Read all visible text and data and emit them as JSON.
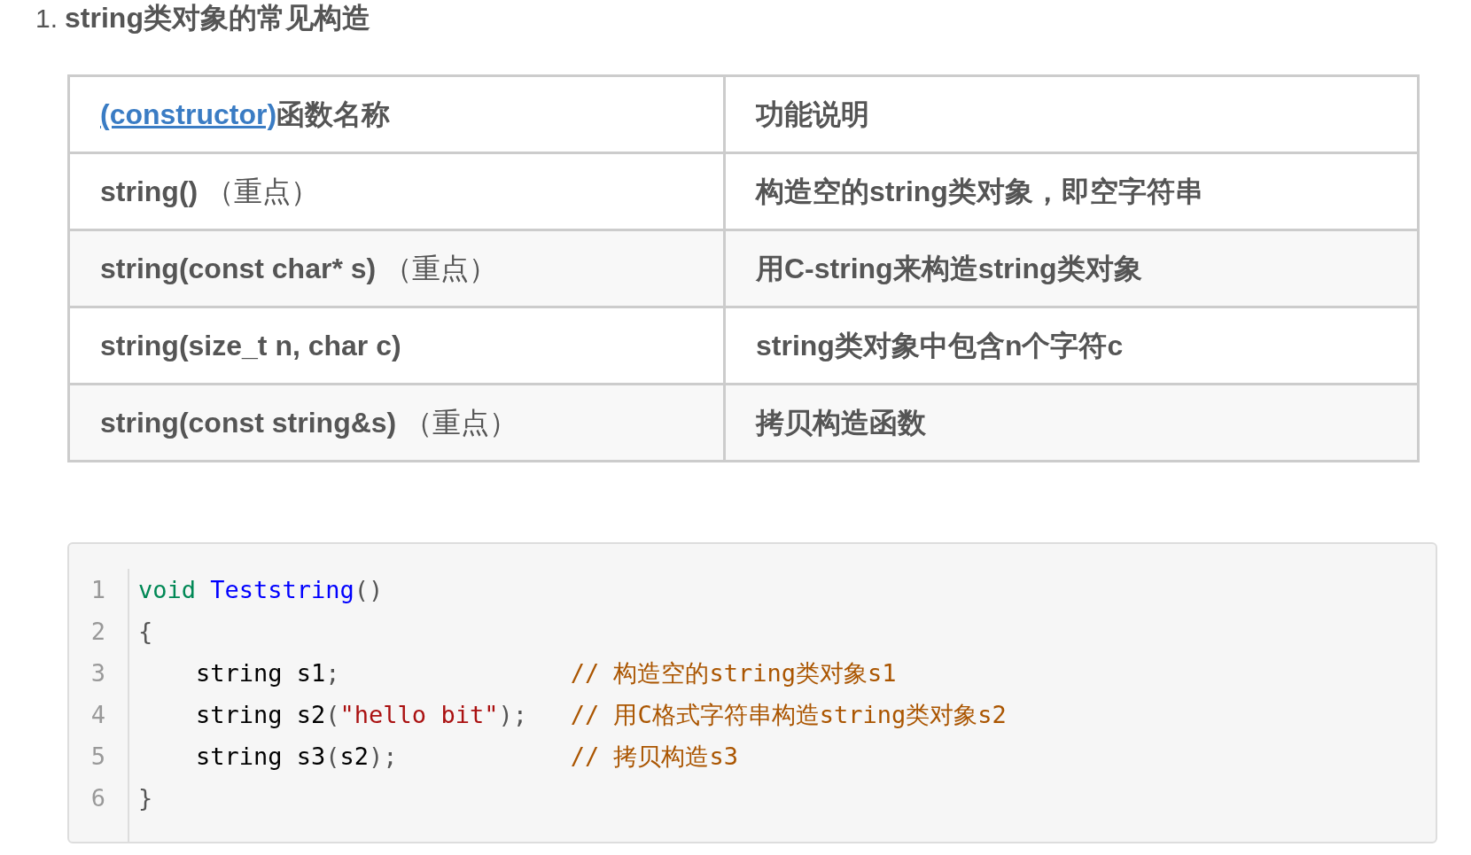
{
  "heading": {
    "number": "1.",
    "text": "string类对象的常见构造"
  },
  "table": {
    "header": {
      "column_1": {
        "link": "(constructor)",
        "text": "函数名称"
      },
      "column_2": "功能说明"
    },
    "rows": [
      {
        "name": "**string()** （重点）",
        "description": "构造空的string类对象，即空字符串"
      },
      {
        "name": "**string(const char* s)** （重点）",
        "description": "用C-string来构造string类对象"
      },
      {
        "name": "**string(size_t n, char c)**",
        "description": "string类对象中包含n个字符c"
      },
      {
        "name": "**string(const string&s)** （重点）",
        "description": "拷贝构造函数"
      }
    ]
  },
  "code": {
    "lines": [
      {
        "number": "1",
        "tokens": [
          {
            "kind": "keyword",
            "text": "void"
          },
          {
            "kind": "function",
            "text": "Teststring",
            "space_before": true
          },
          {
            "kind": "punct",
            "text": "()"
          }
        ]
      },
      {
        "number": "2",
        "tokens": [
          {
            "kind": "punct",
            "text": "{"
          }
        ]
      },
      {
        "number": "3",
        "tokens": [
          {
            "kind": "plain",
            "text": "    string s1"
          },
          {
            "kind": "punct",
            "text": ";"
          }
        ],
        "comment": "// 构造空的string类对象s1"
      },
      {
        "number": "4",
        "tokens": [
          {
            "kind": "plain",
            "text": "    string s2"
          },
          {
            "kind": "punct",
            "text": "("
          },
          {
            "kind": "string",
            "text": "\"hello bit\""
          },
          {
            "kind": "punct",
            "text": ");"
          }
        ],
        "comment": "// 用C格式字符串构造string类对象s2"
      },
      {
        "number": "5",
        "tokens": [
          {
            "kind": "plain",
            "text": "    string s3"
          },
          {
            "kind": "punct",
            "text": "("
          },
          {
            "kind": "plain",
            "text": "s2"
          },
          {
            "kind": "punct",
            "text": ");"
          }
        ],
        "comment": "// 拷贝构造s3"
      },
      {
        "number": "6",
        "tokens": [
          {
            "kind": "punct",
            "text": "}"
          }
        ]
      }
    ]
  }
}
